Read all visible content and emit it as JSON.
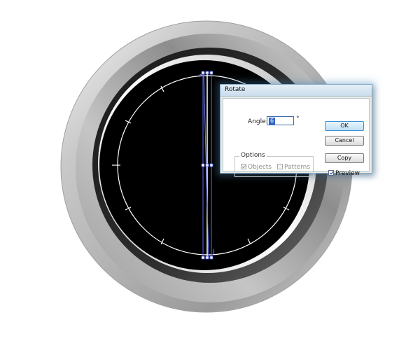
{
  "dialog": {
    "title": "Rotate",
    "angle_label": "Angle:",
    "angle_value": "6",
    "degree_symbol": "°",
    "options_label": "Options",
    "objects_label": "Objects",
    "objects_checked": true,
    "patterns_label": "Patterns",
    "patterns_checked": false,
    "ok_label": "OK",
    "cancel_label": "Cancel",
    "copy_label": "Copy",
    "preview_label": "Preview",
    "preview_checked": true
  },
  "artwork": {
    "description_colors": {
      "background": "#ffffff",
      "bezel_light": "#d9d9d9",
      "bezel_dark": "#4a4a4a",
      "face": "#000000",
      "markers": "#ffffff",
      "selection": "#4a5bd8"
    }
  }
}
